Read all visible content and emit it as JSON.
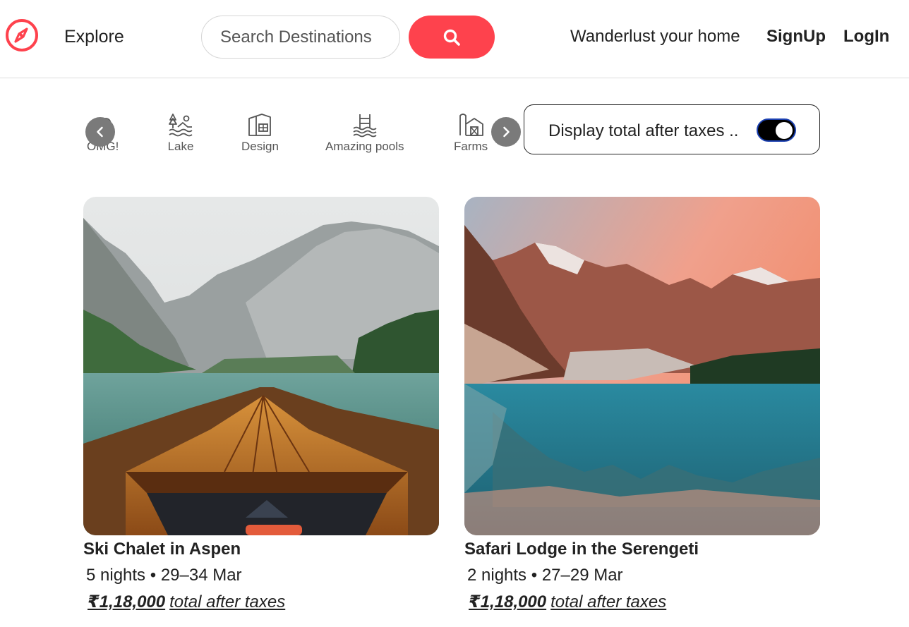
{
  "brand": {
    "accent": "#fe424d",
    "logo_icon": "compass-icon"
  },
  "nav": {
    "explore": "Explore",
    "search_placeholder": "Search Destinations",
    "search_icon": "search-icon",
    "tagline": "Wanderlust your home",
    "signup": "SignUp",
    "login": "LogIn"
  },
  "filters": {
    "items": [
      {
        "label": "OMG!",
        "icon": "omg-icon"
      },
      {
        "label": "Lake",
        "icon": "lake-icon"
      },
      {
        "label": "Design",
        "icon": "design-icon"
      },
      {
        "label": "Amazing pools",
        "icon": "pool-icon"
      },
      {
        "label": "Farms",
        "icon": "farm-icon"
      }
    ],
    "prev_icon": "chevron-left-icon",
    "next_icon": "chevron-right-icon"
  },
  "tax_toggle": {
    "label": "Display total after taxes ..",
    "on": true
  },
  "listings": [
    {
      "title": "Ski Chalet in Aspen",
      "nights": "5 nights",
      "dates": "29–34  Mar",
      "price": "₹1,18,000",
      "price_suffix": "total after taxes"
    },
    {
      "title": "Safari Lodge in the Serengeti",
      "nights": "2 nights",
      "dates": "27–29  Mar",
      "price": "₹1,18,000",
      "price_suffix": "total after taxes"
    }
  ]
}
